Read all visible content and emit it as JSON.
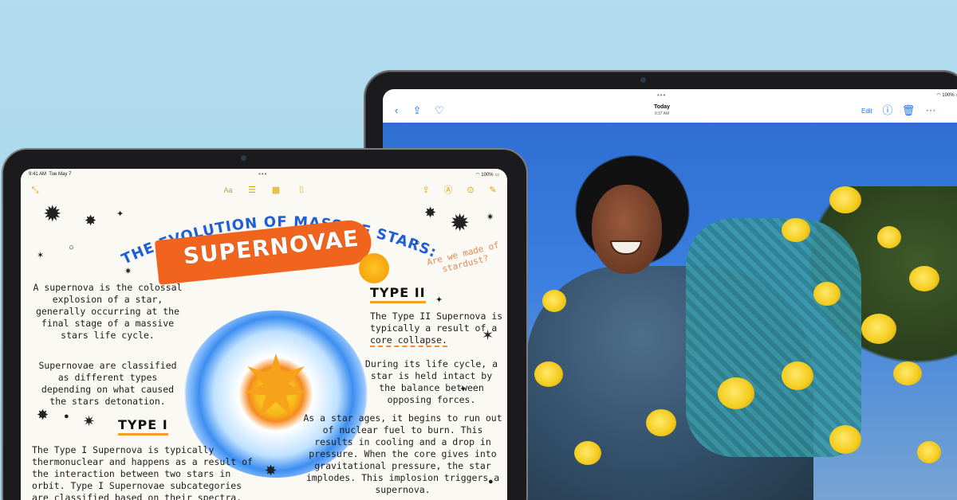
{
  "photos_ipad": {
    "status": {
      "dots": "•••",
      "battery": "100%"
    },
    "toolbar": {
      "title": "Today",
      "subtitle": "9:37 AM",
      "edit_label": "Edit",
      "icons": [
        "chevron-left-icon",
        "share-icon",
        "heart-icon",
        "info-icon",
        "trash-icon",
        "more-icon"
      ]
    }
  },
  "notes_ipad": {
    "status": {
      "time": "9:41 AM",
      "date": "Tue May 7",
      "dots": "•••",
      "battery": "100%"
    },
    "toolbar": {
      "aa_label": "Aa"
    },
    "note": {
      "title": "THE EVOLUTION OF MASSIVE STARS:",
      "banner": "SUPERNOVAE",
      "aside": "Are we made of stardust?",
      "intro": "A supernova is the colossal explosion of a star, generally occurring at the final stage of a massive stars life cycle.",
      "classes": "Supernovae are classified as different types depending on what caused the stars detonation.",
      "type1_heading": "TYPE I",
      "type1_text": "The Type I Supernova is typically thermonuclear and happens as a result of the interaction between two stars in orbit. Type I Supernovae subcategories are classified based on their spectra.",
      "type2_heading": "TYPE II",
      "type2_text_a": "The Type II Supernova is typically a result of a",
      "type2_text_b": "core collapse.",
      "lifecycle": "During its life cycle, a star is held intact by the balance between opposing forces.",
      "aging": "As a star ages, it begins to run out of nuclear fuel to burn. This results in cooling and a drop in pressure. When the core gives into gravitational pressure, the star implodes. This implosion triggers a supernova."
    }
  }
}
